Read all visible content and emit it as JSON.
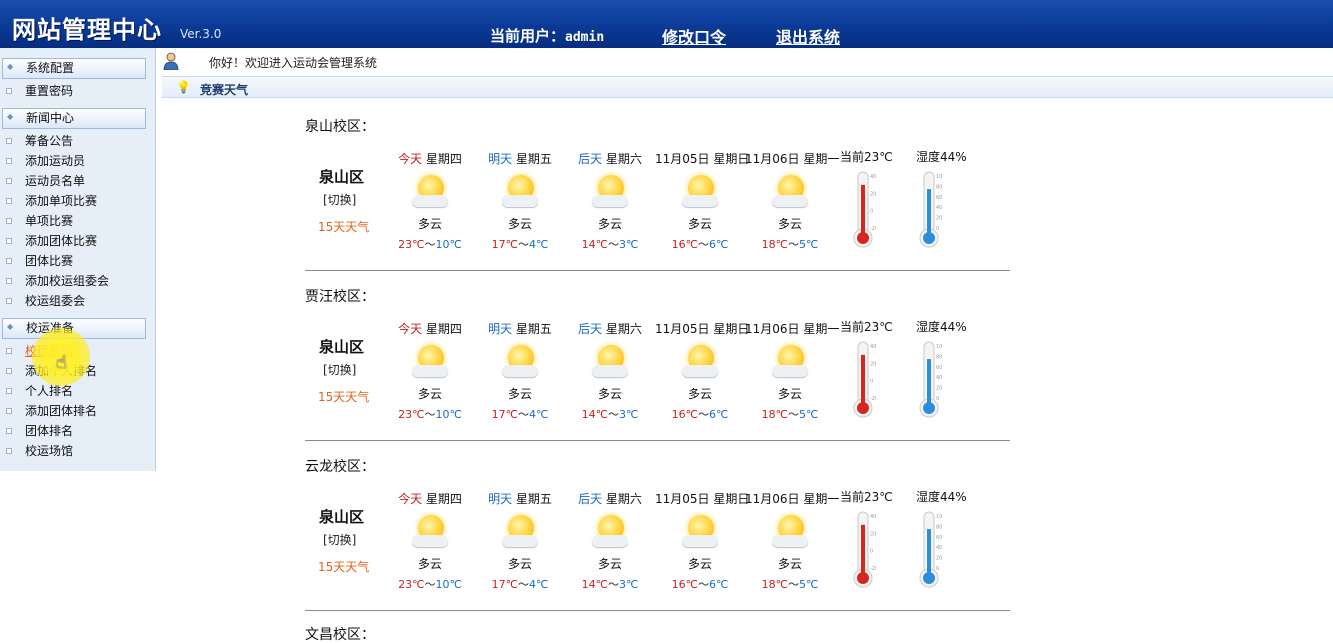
{
  "header": {
    "logo": "网站管理中心",
    "version": "Ver.3.0",
    "current_user_label": "当前用户：",
    "current_user": "admin",
    "change_password": "修改口令",
    "logout": "退出系统"
  },
  "sidebar": {
    "sections": [
      {
        "title": "系统配置",
        "items": [
          "重置密码"
        ]
      },
      {
        "title": "新闻中心",
        "items": [
          "筹备公告",
          "添加运动员",
          "运动员名单",
          "添加单项比赛",
          "单项比赛",
          "添加团体比赛",
          "团体比赛",
          "添加校运组委会",
          "校运组委会"
        ]
      },
      {
        "title": "校运准备",
        "items": [
          "校运新闻",
          "添加个人排名",
          "个人排名",
          "添加团体排名",
          "团体排名",
          "校运场馆"
        ]
      }
    ],
    "active_item": "校运新闻"
  },
  "welcome_text": "你好！欢迎进入运动会管理系统",
  "section_title": "竞赛天气",
  "weather": {
    "city": "泉山区",
    "switch_label": "[切换]",
    "fifteen_day_label": "15天天气",
    "current_temp_label": "当前23℃",
    "humidity_label": "湿度44%",
    "current_temp_c": 23,
    "humidity_pct": 44,
    "thermo_ticks": [
      "40",
      "20",
      "0",
      "-20"
    ],
    "humidity_ticks": [
      "100",
      "80",
      "60",
      "40",
      "20",
      "0"
    ],
    "days": [
      {
        "tag": "今天",
        "weekday": "星期四",
        "tag_color": "#c71f1f",
        "cond": "多云",
        "hi": "23℃",
        "lo": "10℃",
        "icon": "partly-cloudy-icon"
      },
      {
        "tag": "明天",
        "weekday": "星期五",
        "tag_color": "#1a6bc8",
        "cond": "多云",
        "hi": "17℃",
        "lo": "4℃",
        "icon": "partly-cloudy-icon"
      },
      {
        "tag": "后天",
        "weekday": "星期六",
        "tag_color": "#1a6bc8",
        "cond": "多云",
        "hi": "14℃",
        "lo": "3℃",
        "icon": "partly-cloudy-icon"
      },
      {
        "tag": "11月05日",
        "weekday": "星期日",
        "tag_color": "#111111",
        "cond": "多云",
        "hi": "16℃",
        "lo": "6℃",
        "icon": "partly-cloudy-icon"
      },
      {
        "tag": "11月06日",
        "weekday": "星期一",
        "tag_color": "#111111",
        "cond": "多云",
        "hi": "18℃",
        "lo": "5℃",
        "icon": "partly-cloudy-icon"
      }
    ]
  },
  "campuses": [
    {
      "title": "泉山校区："
    },
    {
      "title": "贾汪校区："
    },
    {
      "title": "云龙校区："
    }
  ],
  "next_campus_partial": "文昌校区：",
  "colors": {
    "header_bg": "#0b3a96",
    "sidebar_bg": "#e6eef8",
    "thermo_red": "#d7261e",
    "humidity_blue": "#2a8fd8",
    "accent_orange": "#e4621a"
  }
}
